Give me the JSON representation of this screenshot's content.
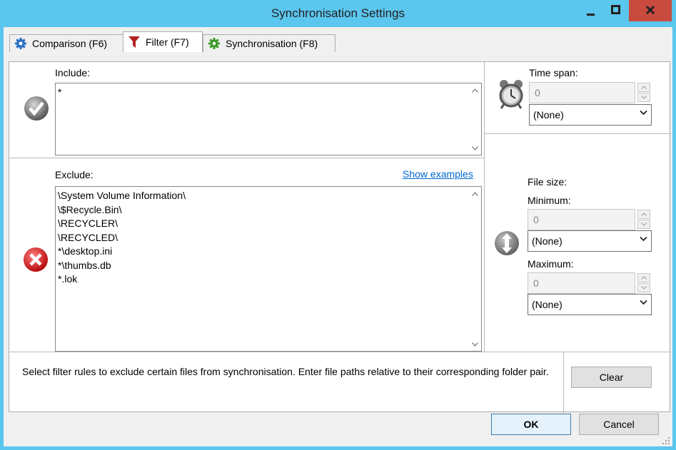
{
  "window": {
    "title": "Synchronisation Settings"
  },
  "tabs": [
    {
      "label": "Comparison (F6)",
      "icon": "gear-icon"
    },
    {
      "label": "Filter (F7)",
      "icon": "filter-icon"
    },
    {
      "label": "Synchronisation (F8)",
      "icon": "gear-icon"
    }
  ],
  "include": {
    "label": "Include:",
    "value": "*"
  },
  "exclude": {
    "label": "Exclude:",
    "show_examples": "Show examples",
    "value": "\\System Volume Information\\\n\\$Recycle.Bin\\\n\\RECYCLER\\\n\\RECYCLED\\\n*\\desktop.ini\n*\\thumbs.db\n*.lok"
  },
  "time_span": {
    "label": "Time span:",
    "value": "0",
    "unit": "(None)"
  },
  "file_size": {
    "label": "File size:",
    "minimum_label": "Minimum:",
    "minimum_value": "0",
    "minimum_unit": "(None)",
    "maximum_label": "Maximum:",
    "maximum_value": "0",
    "maximum_unit": "(None)"
  },
  "help_text": "Select filter rules to exclude certain files from synchronisation. Enter file paths relative to their corresponding folder pair.",
  "buttons": {
    "clear": "Clear",
    "ok": "OK",
    "cancel": "Cancel"
  },
  "colors": {
    "titlebar": "#5bc6ee",
    "close": "#c94a3f",
    "link": "#0066cc",
    "filter_icon": "#b22222",
    "gear_blue": "#2b6fc7",
    "gear_green": "#3a9a2a"
  }
}
